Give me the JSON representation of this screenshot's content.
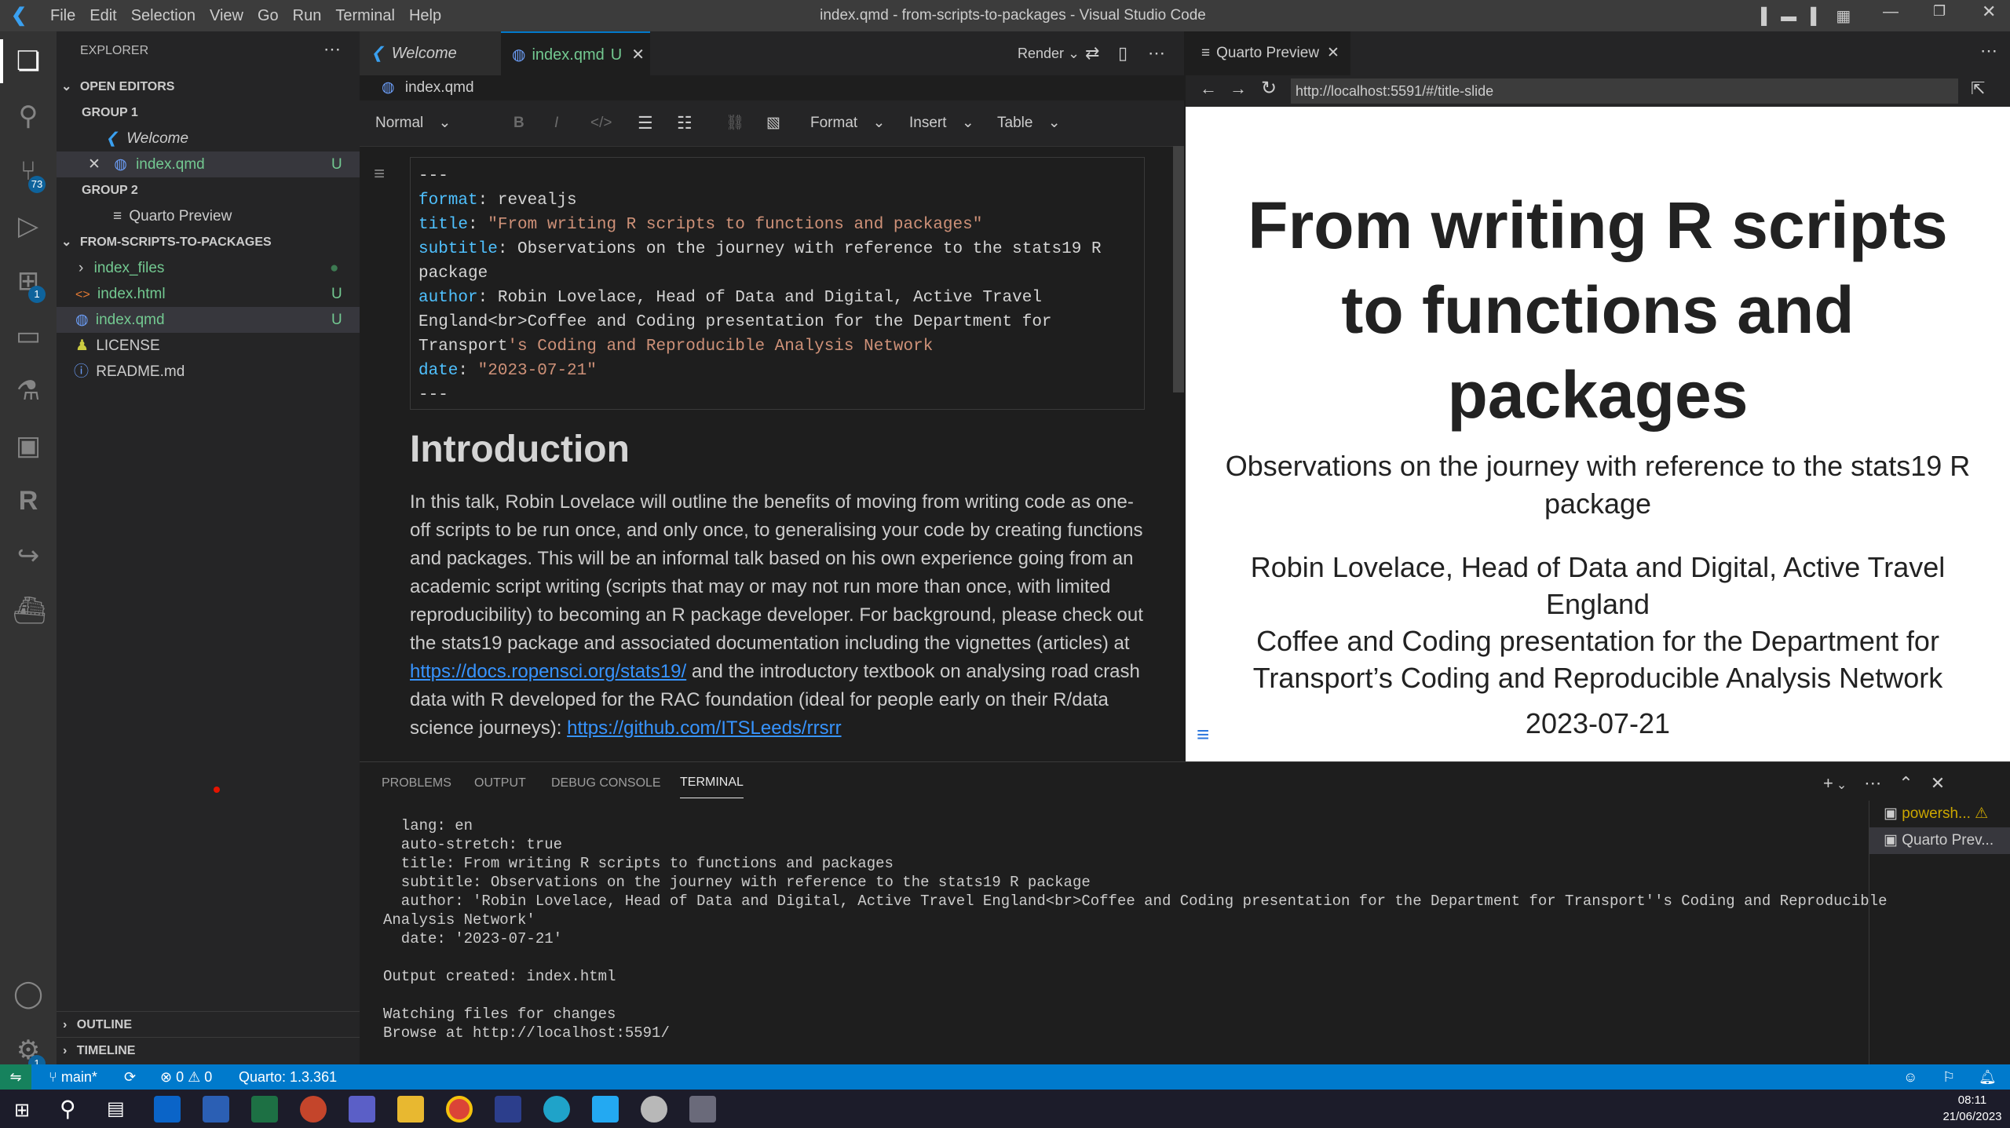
{
  "window": {
    "title": "index.qmd - from-scripts-to-packages - Visual Studio Code",
    "menu": [
      "File",
      "Edit",
      "Selection",
      "View",
      "Go",
      "Run",
      "Terminal",
      "Help"
    ]
  },
  "activity": {
    "scm_badge": "73",
    "extensions_badge": "1",
    "settings_badge": "1"
  },
  "sidebar": {
    "title": "EXPLORER",
    "open_editors": "OPEN EDITORS",
    "group1": "GROUP 1",
    "group1_items": [
      "Welcome",
      "index.qmd"
    ],
    "group1_status": "U",
    "group2": "GROUP 2",
    "group2_item": "Quarto Preview",
    "project": "FROM-SCRIPTS-TO-PACKAGES",
    "files": [
      {
        "name": "index_files",
        "status": ""
      },
      {
        "name": "index.html",
        "status": "U"
      },
      {
        "name": "index.qmd",
        "status": "U"
      },
      {
        "name": "LICENSE",
        "status": ""
      },
      {
        "name": "README.md",
        "status": ""
      }
    ],
    "outline": "OUTLINE",
    "timeline": "TIMELINE"
  },
  "editor": {
    "tabs": [
      {
        "label": "Welcome"
      },
      {
        "label": "index.qmd",
        "status": "U"
      }
    ],
    "render_label": "Render",
    "breadcrumb": "index.qmd",
    "toolbar": {
      "style": "Normal",
      "format": "Format",
      "insert": "Insert",
      "table": "Table"
    },
    "yaml": {
      "delim": "---",
      "format_key": "format",
      "format_val": "revealjs",
      "title_key": "title",
      "title_val": "\"From writing R scripts to functions and packages\"",
      "subtitle_key": "subtitle",
      "subtitle_val1": "Observations on the journey with reference to the stats19 R",
      "subtitle_val2": "package",
      "author_key": "author",
      "author_val1": "Robin Lovelace, Head of Data and Digital, Active Travel",
      "author_val2": "England<br>Coffee and Coding presentation for the Department for",
      "author_val3a": "Transport",
      "author_val3b": "'s Coding and Reproducible Analysis Network",
      "date_key": "date",
      "date_val": "\"2023-07-21\""
    },
    "heading": "Introduction",
    "para_1": "In this talk, Robin Lovelace will outline the benefits of moving from writing code as one-off scripts to be run once, and only once, to generalising your code by creating functions and packages. This will be an informal talk based on his own experience going from an academic script writing (scripts that may or may  not run more than once, with limited reproducibility) to becoming an R package developer. For background, please check out the stats19 package and associated documentation including the vignettes (articles) at ",
    "link_1": "https://docs.ropensci.org/stats19/",
    "para_2": " and the introductory textbook on analysing road crash data with R developed for the RAC foundation (ideal for people early on their R/data science journeys): ",
    "link_2": "https://github.com/ITSLeeds/rrsrr"
  },
  "preview": {
    "tab": "Quarto Preview",
    "url": "http://localhost:5591/#/title-slide",
    "title_1": "From writing R scripts",
    "title_2": "to functions and",
    "title_3": "packages",
    "subtitle_1": "Observations on the journey with reference to the stats19 R",
    "subtitle_2": "package",
    "author_1": "Robin Lovelace, Head of Data and Digital, Active Travel",
    "author_2": "England",
    "author_3": "Coffee and Coding presentation for the Department for",
    "author_4": "Transport’s Coding and Reproducible Analysis Network",
    "date": "2023-07-21"
  },
  "panel": {
    "tabs": [
      "PROBLEMS",
      "OUTPUT",
      "DEBUG CONSOLE",
      "TERMINAL"
    ],
    "terminal": "  lang: en\n  auto-stretch: true\n  title: From writing R scripts to functions and packages\n  subtitle: Observations on the journey with reference to the stats19 R package\n  author: 'Robin Lovelace, Head of Data and Digital, Active Travel England<br>Coffee and Coding presentation for the Department for Transport''s Coding and Reproducible\nAnalysis Network'\n  date: '2023-07-21'\n\nOutput created: index.html\n\nWatching files for changes\nBrowse at http://localhost:5591/",
    "terminals": [
      "powersh...",
      "Quarto Prev..."
    ]
  },
  "status": {
    "branch": "main*",
    "errors": "0",
    "warnings": "0",
    "quarto": "Quarto: 1.3.361"
  },
  "taskbar": {
    "time": "08:11",
    "date": "21/06/2023"
  }
}
